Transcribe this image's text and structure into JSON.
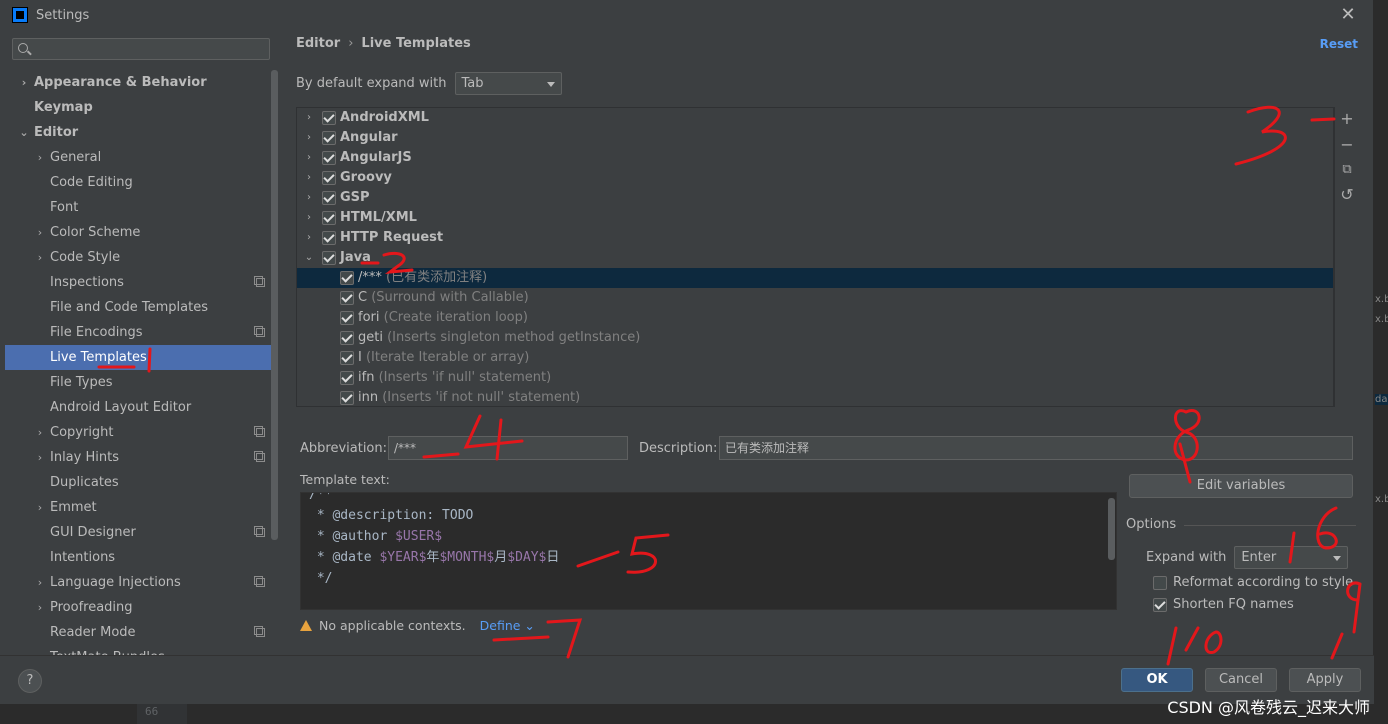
{
  "window": {
    "title": "Settings"
  },
  "sidebar": {
    "items": [
      {
        "label": "Appearance & Behavior",
        "level": 0,
        "bold": true,
        "arrow": "collapsed"
      },
      {
        "label": "Keymap",
        "level": 0,
        "bold": true,
        "arrow": "none"
      },
      {
        "label": "Editor",
        "level": 0,
        "bold": true,
        "arrow": "expanded"
      },
      {
        "label": "General",
        "level": 1,
        "arrow": "collapsed"
      },
      {
        "label": "Code Editing",
        "level": 1,
        "arrow": "none"
      },
      {
        "label": "Font",
        "level": 1,
        "arrow": "none"
      },
      {
        "label": "Color Scheme",
        "level": 1,
        "arrow": "collapsed"
      },
      {
        "label": "Code Style",
        "level": 1,
        "arrow": "collapsed"
      },
      {
        "label": "Inspections",
        "level": 1,
        "arrow": "none",
        "icon": true
      },
      {
        "label": "File and Code Templates",
        "level": 1,
        "arrow": "none"
      },
      {
        "label": "File Encodings",
        "level": 1,
        "arrow": "none",
        "icon": true
      },
      {
        "label": "Live Templates",
        "level": 1,
        "arrow": "none",
        "selected": true
      },
      {
        "label": "File Types",
        "level": 1,
        "arrow": "none"
      },
      {
        "label": "Android Layout Editor",
        "level": 1,
        "arrow": "none"
      },
      {
        "label": "Copyright",
        "level": 1,
        "arrow": "collapsed",
        "icon": true
      },
      {
        "label": "Inlay Hints",
        "level": 1,
        "arrow": "collapsed",
        "icon": true
      },
      {
        "label": "Duplicates",
        "level": 1,
        "arrow": "none"
      },
      {
        "label": "Emmet",
        "level": 1,
        "arrow": "collapsed"
      },
      {
        "label": "GUI Designer",
        "level": 1,
        "arrow": "none",
        "icon": true
      },
      {
        "label": "Intentions",
        "level": 1,
        "arrow": "none"
      },
      {
        "label": "Language Injections",
        "level": 1,
        "arrow": "collapsed",
        "icon": true
      },
      {
        "label": "Proofreading",
        "level": 1,
        "arrow": "collapsed"
      },
      {
        "label": "Reader Mode",
        "level": 1,
        "arrow": "none",
        "icon": true
      },
      {
        "label": "TextMate Bundles",
        "level": 1,
        "arrow": "none"
      }
    ]
  },
  "header": {
    "breadcrumb_parent": "Editor",
    "breadcrumb_sep": "›",
    "breadcrumb_current": "Live Templates",
    "reset_label": "Reset"
  },
  "expand_default": {
    "label": "By default expand with",
    "value": "Tab"
  },
  "templates": [
    {
      "kind": "group",
      "name": "AndroidXML",
      "expanded": false
    },
    {
      "kind": "group",
      "name": "Angular",
      "expanded": false
    },
    {
      "kind": "group",
      "name": "AngularJS",
      "expanded": false
    },
    {
      "kind": "group",
      "name": "Groovy",
      "expanded": false
    },
    {
      "kind": "group",
      "name": "GSP",
      "expanded": false
    },
    {
      "kind": "group",
      "name": "HTML/XML",
      "expanded": false
    },
    {
      "kind": "group",
      "name": "HTTP Request",
      "expanded": false
    },
    {
      "kind": "group",
      "name": "Java",
      "expanded": true
    },
    {
      "kind": "item",
      "name": "/***",
      "desc": "(已有类添加注释)",
      "selected": true
    },
    {
      "kind": "item",
      "name": "C",
      "desc": "(Surround with Callable)"
    },
    {
      "kind": "item",
      "name": "fori",
      "desc": "(Create iteration loop)"
    },
    {
      "kind": "item",
      "name": "geti",
      "desc": "(Inserts singleton method getInstance)"
    },
    {
      "kind": "item",
      "name": "I",
      "desc": "(Iterate Iterable or array)"
    },
    {
      "kind": "item",
      "name": "ifn",
      "desc": "(Inserts 'if null' statement)"
    },
    {
      "kind": "item",
      "name": "inn",
      "desc": "(Inserts 'if not null' statement)"
    }
  ],
  "toolbar": {
    "add": "+",
    "remove": "−",
    "copy": "⧉",
    "restore": "↺"
  },
  "details": {
    "abbreviation_label": "Abbreviation:",
    "abbreviation_value": "/***",
    "description_label": "Description:",
    "description_value": "已有类添加注释",
    "template_text_label": "Template text:",
    "edit_variables_label": "Edit variables"
  },
  "template_code": {
    "line0": "/**",
    "line1_tag": " * @description:",
    "line1_rest": " TODO",
    "line2_tag": " * @author",
    "line2_var": " $USER$",
    "line3_tag": " * @date",
    "line3_v1": " $YEAR$",
    "line3_t1": "年",
    "line3_v2": "$MONTH$",
    "line3_t2": "月",
    "line3_v3": "$DAY$",
    "line3_t3": "日",
    "line4": " */"
  },
  "options": {
    "title": "Options",
    "expand_with_label": "Expand with",
    "expand_with_value": "Enter",
    "reformat_label": "Reformat according to style",
    "reformat_checked": false,
    "shorten_label": "Shorten FQ names",
    "shorten_checked": true
  },
  "context": {
    "warning_text": "No applicable contexts.",
    "define_label": "Define ⌄"
  },
  "buttons": {
    "ok": "OK",
    "cancel": "Cancel",
    "apply": "Apply",
    "help": "?"
  },
  "background": {
    "gutter_line": "66"
  },
  "watermark": "CSDN @风卷残云_迟来大师",
  "annotations": [
    "1",
    "2",
    "3",
    "4",
    "5",
    "6",
    "7",
    "8",
    "9",
    "10"
  ],
  "colors": {
    "accent": "#4b6eaf",
    "link": "#589df6",
    "annotation": "#e3171b",
    "primary_button": "#365880"
  }
}
